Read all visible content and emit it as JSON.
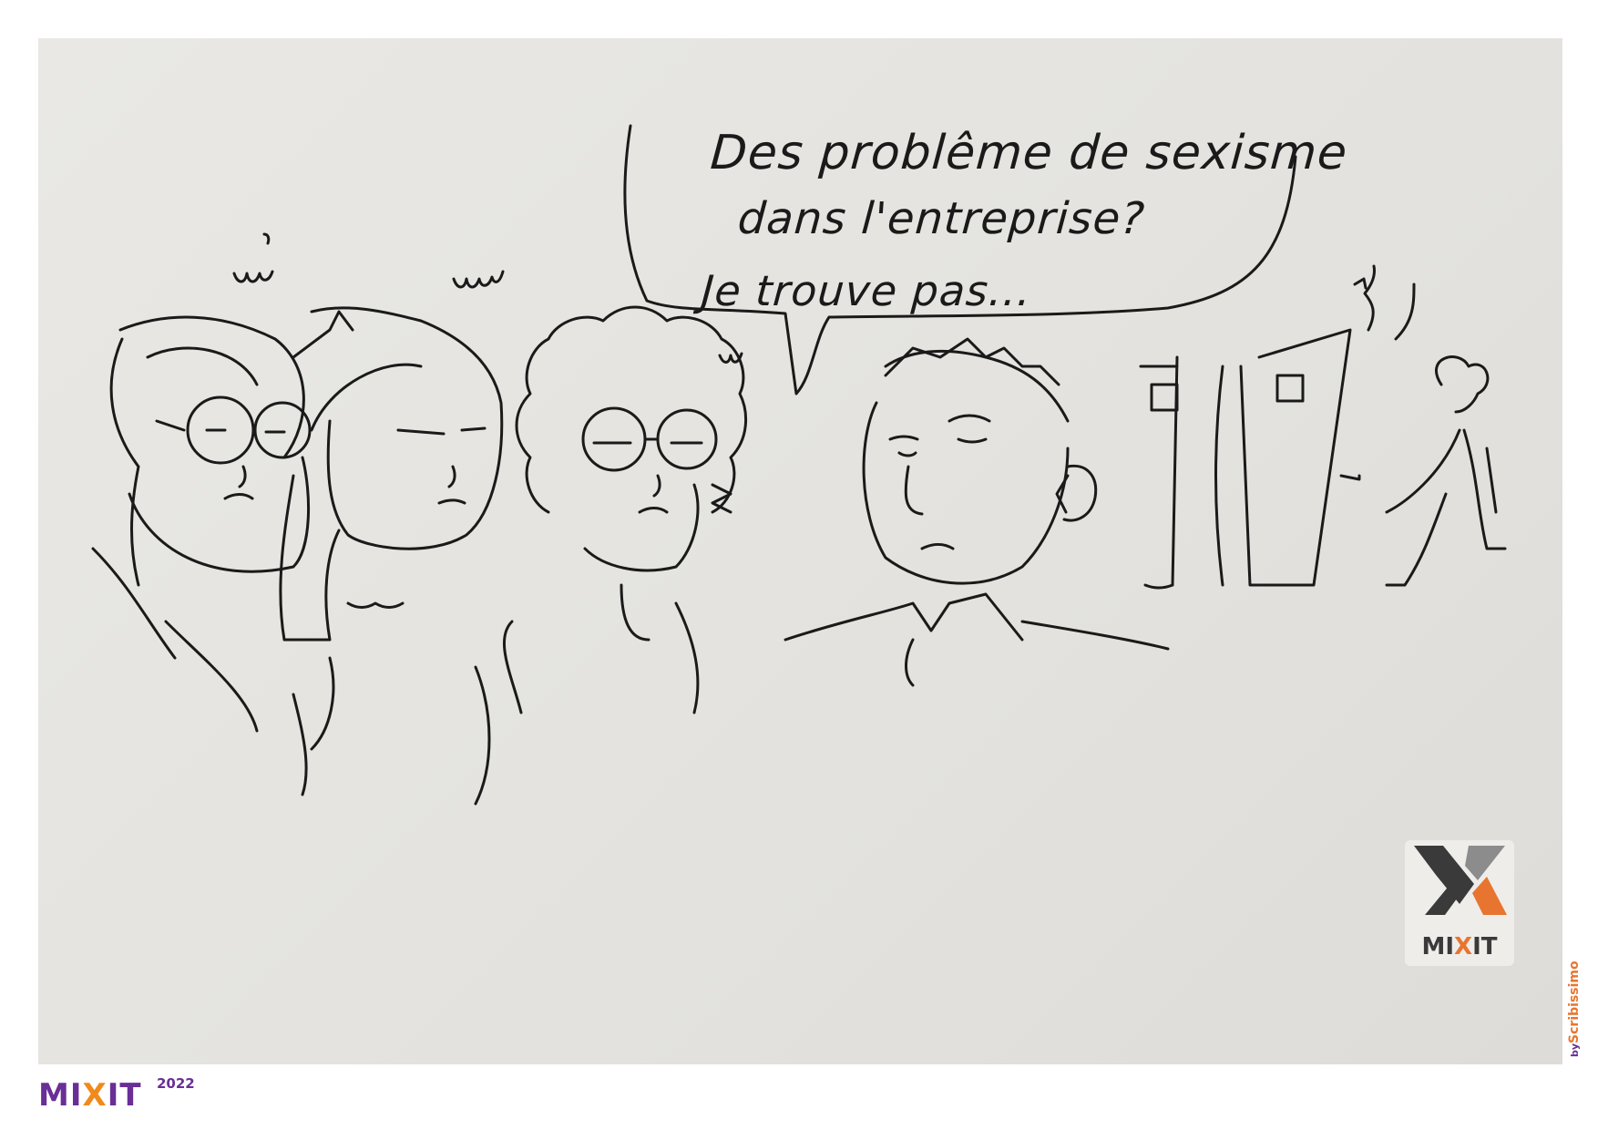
{
  "speech_bubble": {
    "line1": "Des problême de sexisme",
    "line2": "dans l'entreprise?",
    "line3": "Je trouve pas..."
  },
  "sticker": {
    "brand_prefix": "MI",
    "brand_x": "X",
    "brand_suffix": "IT",
    "colors": {
      "dark": "#3a3a3a",
      "orange": "#e8752f",
      "grey": "#8c8c8c"
    }
  },
  "footer": {
    "logo_prefix": "MI",
    "logo_x": "X",
    "logo_suffix": "IT",
    "year": "2022",
    "colors": {
      "purple": "#6a2e97",
      "orange": "#f08a1c"
    }
  },
  "credit": {
    "by": "by",
    "name": "Scribissimo"
  }
}
